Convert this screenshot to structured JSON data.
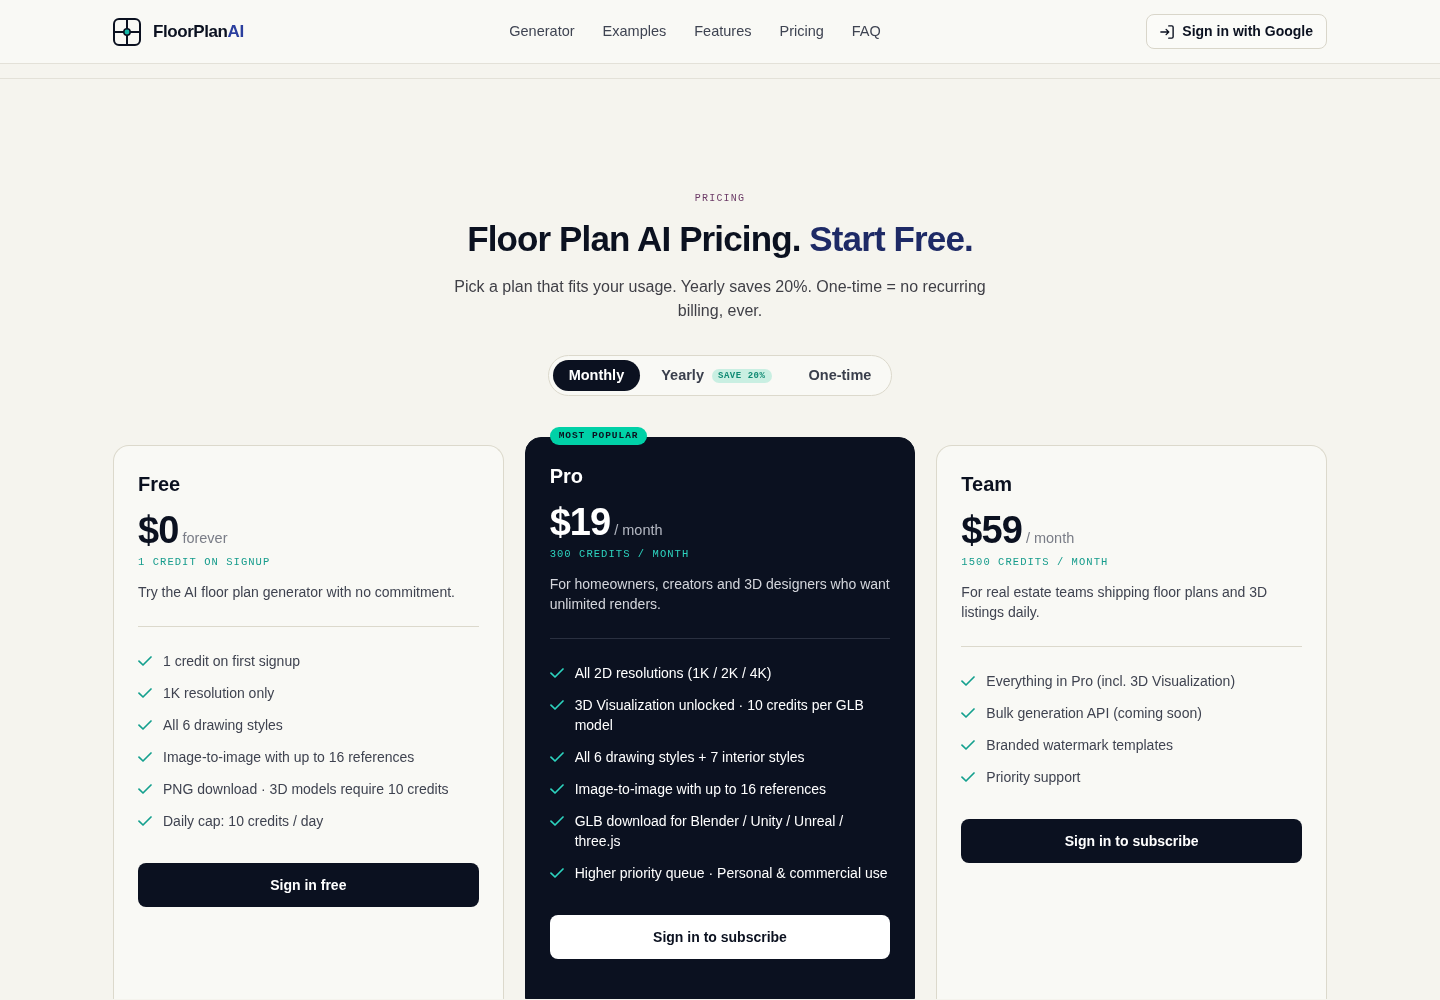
{
  "header": {
    "logo": {
      "text": "FloorPlan",
      "accent": "AI"
    },
    "nav": [
      "Generator",
      "Examples",
      "Features",
      "Pricing",
      "FAQ"
    ],
    "sign_in_button": "Sign in with Google"
  },
  "hero": {
    "eyebrow": "PRICING",
    "title": "Floor Plan AI Pricing.",
    "title_accent": "Start Free.",
    "subtitle": "Pick a plan that fits your usage. Yearly saves 20%. One-time = no recurring billing, ever."
  },
  "billing_toggle": [
    {
      "label": "Monthly",
      "selected": true
    },
    {
      "label": "Yearly",
      "selected": false,
      "badge": "SAVE 20%"
    },
    {
      "label": "One-time",
      "selected": false
    }
  ],
  "plans": [
    {
      "name": "Free",
      "featured": false,
      "price": "$0",
      "period": "forever",
      "credits": "1 CREDIT ON SIGNUP",
      "description": "Try the AI floor plan generator with no commitment.",
      "features": [
        "1 credit on first signup",
        "1K resolution only",
        "All 6 drawing styles",
        "Image-to-image with up to 16 references",
        "PNG download · 3D models require 10 credits",
        "Daily cap: 10 credits / day"
      ],
      "button": "Sign in free"
    },
    {
      "name": "Pro",
      "featured": true,
      "badge": "MOST POPULAR",
      "price": "$19",
      "period": "/ month",
      "credits": "300 CREDITS / MONTH",
      "description": "For homeowners, creators and 3D designers who want unlimited renders.",
      "features": [
        "All 2D resolutions (1K / 2K / 4K)",
        "3D Visualization unlocked · 10 credits per GLB model",
        "All 6 drawing styles + 7 interior styles",
        "Image-to-image with up to 16 references",
        "GLB download for Blender / Unity / Unreal / three.js",
        "Higher priority queue · Personal & commercial use"
      ],
      "button": "Sign in to subscribe"
    },
    {
      "name": "Team",
      "featured": false,
      "price": "$59",
      "period": "/ month",
      "credits": "1500 CREDITS / MONTH",
      "description": "For real estate teams shipping floor plans and 3D listings daily.",
      "features": [
        "Everything in Pro (incl. 3D Visualization)",
        "Bulk generation API (coming soon)",
        "Branded watermark templates",
        "Priority support"
      ],
      "button": "Sign in to subscribe"
    }
  ]
}
